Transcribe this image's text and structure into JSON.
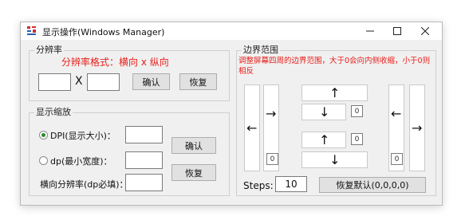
{
  "window": {
    "title": "显示操作(Windows Manager)",
    "controls": {
      "minimize": "—",
      "maximize": "☐",
      "close": "✕"
    }
  },
  "resolution": {
    "group_title": "分辨率",
    "format_hint": "分辨率格式：横向 x 纵向",
    "width_value": "",
    "x_separator": "X",
    "height_value": "",
    "confirm_label": "确认",
    "restore_label": "恢复"
  },
  "scaling": {
    "group_title": "显示缩放",
    "dpi_label": "DPI(显示大小)：",
    "dpi_selected": true,
    "dp_label": "dp(最小宽度)：",
    "dp_selected": false,
    "dp_width_label": "横向分辨率(dp必填)：",
    "dpi_value": "",
    "dp_value": "",
    "dp_width_value": "",
    "confirm_label": "确认",
    "restore_label": "恢复"
  },
  "border": {
    "group_title": "边界范围",
    "hint": "调整屏幕四周的边界范围，大于0会向内侧收缩，小于0则相反",
    "left": {
      "value": "0",
      "left_arrow": "←",
      "right_arrow": "→"
    },
    "top": {
      "value": "0",
      "up_arrow": "↑",
      "down_arrow": "↓"
    },
    "bottom": {
      "value": "0",
      "up_arrow": "↑",
      "down_arrow": "↓"
    },
    "right": {
      "value": "0",
      "left_arrow": "←",
      "right_arrow": "→"
    },
    "steps_label": "Steps:",
    "steps_value": "10",
    "reset_label": "恢复默认(0,0,0,0)"
  },
  "colors": {
    "hint_red": "#e8201b",
    "radio_green": "#2a8a2a",
    "window_bg": "#f0f0f0"
  }
}
